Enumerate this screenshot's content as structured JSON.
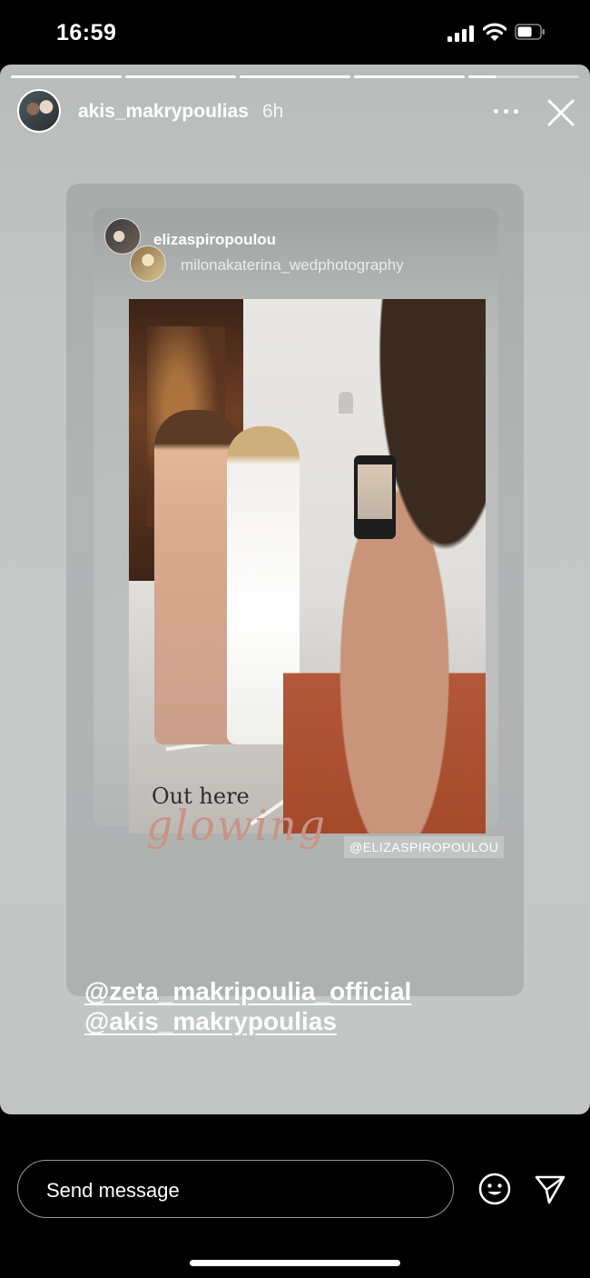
{
  "status_bar": {
    "time": "16:59"
  },
  "story": {
    "progress_segments": 5,
    "current_segment": 5,
    "author": "akis_makrypoulias",
    "age": "6h",
    "reshared_post": {
      "user_primary": "elizaspiropoulou",
      "user_secondary": "milonakaterina_wedphotography",
      "caption_line1": "Out here",
      "caption_line2": "glowing",
      "credit_tag": "@ELIZASPIROPOULOU"
    },
    "mentions": [
      "@zeta_makripoulia_official",
      "@akis_makrypoulias"
    ]
  },
  "footer": {
    "message_placeholder": "Send message"
  },
  "icons": {
    "more": "more-icon",
    "close": "close-icon",
    "emoji": "emoji-icon",
    "send": "send-icon"
  }
}
